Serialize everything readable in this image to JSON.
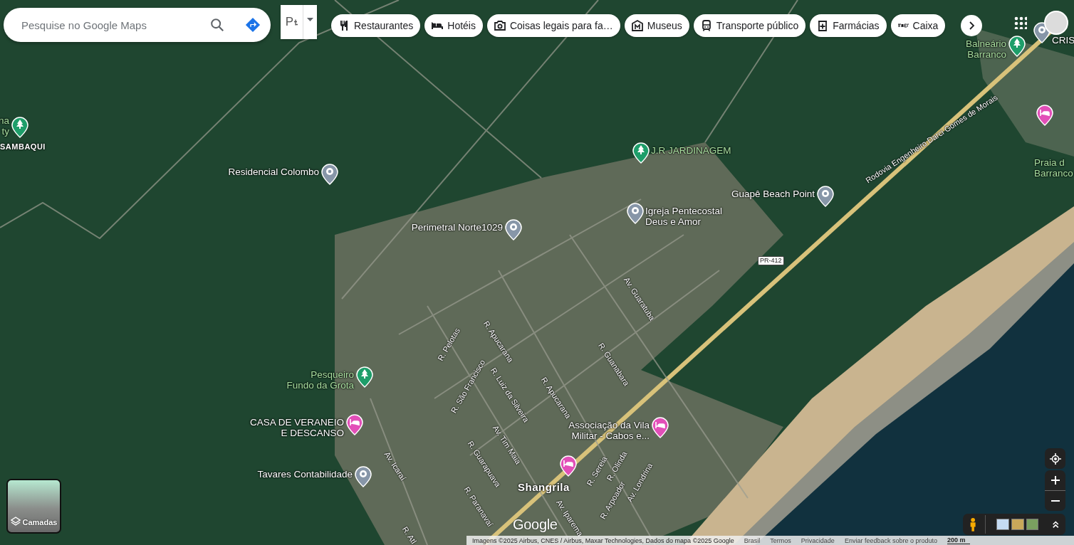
{
  "search": {
    "placeholder": "Pesquise no Google Maps"
  },
  "parking_toggle": {
    "label": "P"
  },
  "chips": [
    {
      "kind": "restaurants",
      "label": "Restaurantes"
    },
    {
      "kind": "hotels",
      "label": "Hotéis"
    },
    {
      "kind": "attractions",
      "label": "Coisas legais para fa…"
    },
    {
      "kind": "museums",
      "label": "Museus"
    },
    {
      "kind": "transit",
      "label": "Transporte público"
    },
    {
      "kind": "pharmacies",
      "label": "Farmácias"
    },
    {
      "kind": "atm",
      "label": "Caixa"
    }
  ],
  "places": [
    {
      "kind": "park",
      "color": "#1e9e6a",
      "name": "na\nty"
    },
    {
      "kind": "area",
      "name": "SAMBAQUI"
    },
    {
      "kind": "place",
      "color": "#8796a8",
      "name": "Residencial Colombo"
    },
    {
      "kind": "park",
      "color": "#1e9e6a",
      "name": "J.R JARDINAGEM"
    },
    {
      "kind": "place",
      "color": "#8796a8",
      "name": "Igreja Pentecostal\nDeus e Amor"
    },
    {
      "kind": "place",
      "color": "#8796a8",
      "name": "Guapê Beach Point"
    },
    {
      "kind": "place",
      "color": "#8796a8",
      "name": "Perimetral Norte1029"
    },
    {
      "kind": "park",
      "color": "#1e9e6a",
      "name": "Pesqueiro\nFundo da Grota"
    },
    {
      "kind": "hotel",
      "color": "#e24fb8",
      "name": "CASA DE VERANEIO\nE DESCANSO"
    },
    {
      "kind": "place",
      "color": "#8796a8",
      "name": "Tavares Contabilidade"
    },
    {
      "kind": "hotel",
      "color": "#e24fb8",
      "name": "Associação da Vila\nMilitar - Cabos e..."
    },
    {
      "kind": "hotel",
      "color": "#e24fb8"
    },
    {
      "kind": "area",
      "name": "Shangrila"
    },
    {
      "kind": "place",
      "color": "#8796a8",
      "name": "CRIS"
    },
    {
      "kind": "park",
      "color": "#1e9e6a",
      "name": "Balneário\nBarranco"
    },
    {
      "kind": "hotel",
      "color": "#e24fb8"
    },
    {
      "kind": "beach",
      "name": "Praia d\nBarranco"
    }
  ],
  "streets": [
    "R. Pelotas",
    "R. Apucarana",
    "R. São Francisco",
    "R. Luiz da Silveira",
    "Av. Tim Maia",
    "R. Apucarana",
    "R. Guarapuava",
    "R. Paranavaí",
    "Av. Icaraí",
    "R. Atl",
    "Av. Guaratuba",
    "R. Guanabara",
    "R. Sereia",
    "R. Olinda",
    "R. Arpoador",
    "Av. Londrina",
    "Av. Iparema",
    "Rodovia Engenheiro Darci Gomes de Morais"
  ],
  "road_shield": "PR-412",
  "logo": "Google",
  "layers_button": {
    "label": "Camadas"
  },
  "footer": [
    "Imagens ©2025 Airbus, CNES / Airbus, Maxar Technologies, Dados do mapa ©2025 Google",
    "Brasil",
    "Termos",
    "Privacidade",
    "Enviar feedback sobre o produto"
  ],
  "scale": "200 m"
}
